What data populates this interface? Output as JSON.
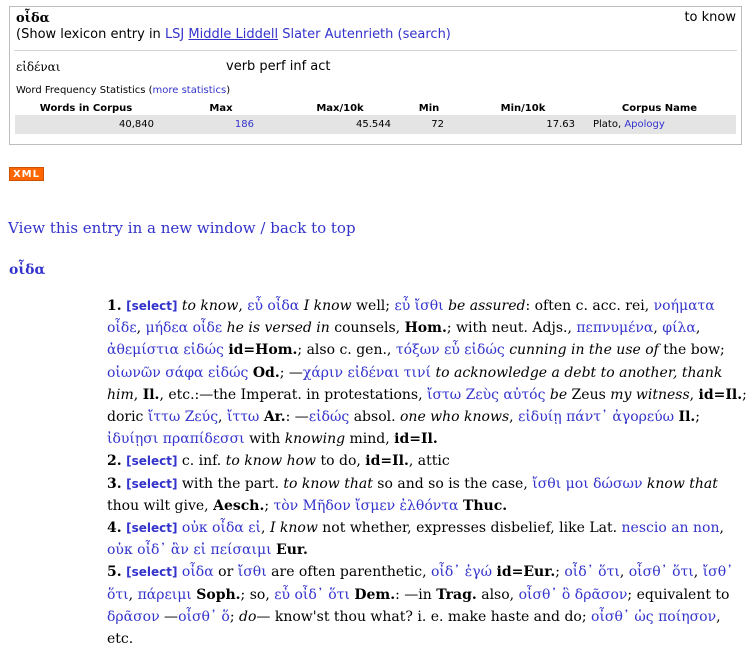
{
  "word_box": {
    "lemma": "οἶδα",
    "gloss": "to know",
    "lexicon_prefix": "(Show lexicon entry in ",
    "lexicons": [
      "LSJ",
      "Middle Liddell",
      "Slater",
      "Autenrieth"
    ],
    "search_label": "(search)",
    "form": "εἰδέναι",
    "parse": "verb perf inf act",
    "freq_title": "Word Frequency Statistics (",
    "more_stats": "more statistics",
    "freq_title_end": ")",
    "columns": [
      "Words in Corpus",
      "Max",
      "Max/10k",
      "Min",
      "Min/10k",
      "Corpus Name"
    ],
    "row": {
      "words": "40,840",
      "max": "186",
      "max10k": "45.544",
      "min": "72",
      "min10k": "17.63",
      "corpus": "Plato, ",
      "corpus_link": "Apology"
    }
  },
  "xml_badge": "XML",
  "nav": {
    "view_new_window": "View this entry in a new window",
    "separator": "/",
    "back_to_top": "back to top"
  },
  "entry": {
    "headword": "οἶδα",
    "select_label": "[select]"
  },
  "accent_colors": {
    "link": "#3333cc",
    "xml_badge": "#ff6600"
  }
}
